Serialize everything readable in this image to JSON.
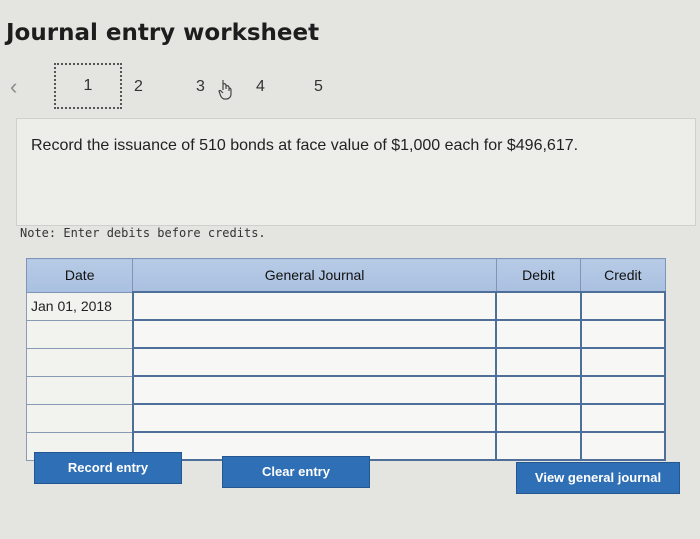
{
  "title": "Journal entry worksheet",
  "pager": {
    "steps": [
      "1",
      "2",
      "3",
      "4",
      "5"
    ],
    "active": "1"
  },
  "question": "Record the issuance of 510 bonds at face value of $1,000 each for $496,617.",
  "note": "Note: Enter debits before credits.",
  "table": {
    "headers": [
      "Date",
      "General Journal",
      "Debit",
      "Credit"
    ],
    "rows": [
      [
        "Jan 01, 2018",
        "",
        "",
        ""
      ],
      [
        "",
        "",
        "",
        ""
      ],
      [
        "",
        "",
        "",
        ""
      ],
      [
        "",
        "",
        "",
        ""
      ],
      [
        "",
        "",
        "",
        ""
      ],
      [
        "",
        "",
        "",
        ""
      ]
    ]
  },
  "buttons": {
    "record": "Record entry",
    "clear": "Clear entry",
    "view": "View general journal"
  },
  "colors": {
    "accent": "#2f6fb5",
    "header": "#b7cbe6"
  }
}
